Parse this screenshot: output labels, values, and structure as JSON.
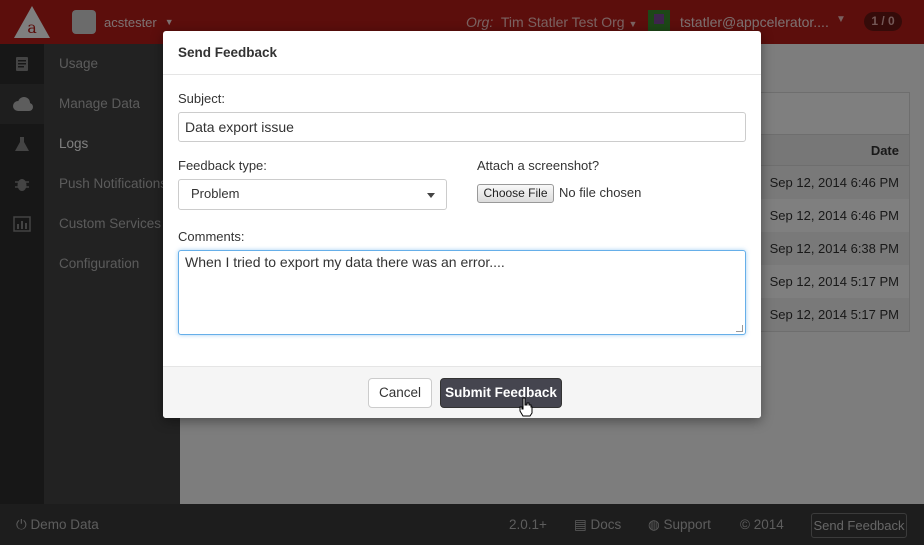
{
  "topbar": {
    "logo_letter": "a",
    "app_name": "acstester",
    "org_label": "Org:",
    "org_name": "Tim Statler Test Org",
    "user_email": "tstatler@appcelerator....",
    "notifications": "1 / 0"
  },
  "sidebar": {
    "items": [
      {
        "label": "Usage",
        "icon": "document-icon"
      },
      {
        "label": "Manage Data",
        "icon": "cloud-icon"
      },
      {
        "label": "Logs",
        "icon": "flask-icon"
      },
      {
        "label": "Push Notifications",
        "icon": "bug-icon"
      },
      {
        "label": "Custom Services",
        "icon": "bar-chart-icon"
      },
      {
        "label": "Configuration",
        "icon": ""
      }
    ]
  },
  "table": {
    "header": "Date",
    "rows": [
      "Sep 12, 2014 6:46 PM",
      "Sep 12, 2014 6:46 PM",
      "Sep 12, 2014 6:38 PM",
      "Sep 12, 2014 5:17 PM",
      "Sep 12, 2014 5:17 PM"
    ]
  },
  "footer": {
    "demo_data": "Demo Data",
    "version": "2.0.1+",
    "docs": "Docs",
    "support": "Support",
    "copyright": "© 2014",
    "send_feedback": "Send Feedback"
  },
  "modal": {
    "title": "Send Feedback",
    "subject_label": "Subject:",
    "subject_value": "Data export issue",
    "feedback_type_label": "Feedback type:",
    "feedback_type_value": "Problem",
    "attach_label": "Attach a screenshot?",
    "choose_file": "Choose File",
    "no_file": "No file chosen",
    "comments_label": "Comments:",
    "comments_value": "When I tried to export my data there was an error....",
    "cancel": "Cancel",
    "submit": "Submit Feedback"
  },
  "colors": {
    "brand_red": "#b81d19",
    "primary_button": "#45454f",
    "focus_blue": "#66afe9"
  }
}
